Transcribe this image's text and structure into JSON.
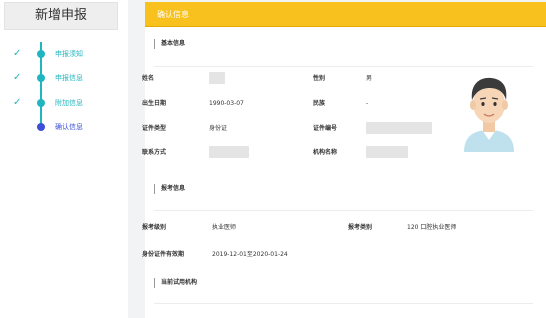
{
  "sidebar": {
    "title": "新增申报",
    "steps": [
      {
        "label": "申报须知",
        "done": true
      },
      {
        "label": "申报信息",
        "done": true
      },
      {
        "label": "附加信息",
        "done": true
      },
      {
        "label": "确认信息",
        "current": true
      }
    ],
    "check_icon": "✓"
  },
  "main": {
    "header_title": "确认信息",
    "basic_info": {
      "title": "基本信息",
      "name_label": "姓名",
      "gender_label": "性别",
      "gender": "男",
      "birth_label": "出生日期",
      "birth": "1990-03-07",
      "ethnicity_label": "民族",
      "ethnicity": "-",
      "id_type_label": "证件类型",
      "id_type": "身份证",
      "id_number_label": "证件编号",
      "contact_label": "联系方式",
      "org_label": "机构名称"
    },
    "exam_info": {
      "title": "报考信息",
      "level_label": "报考级别",
      "level": "执业医师",
      "category_label": "报考类别",
      "category": "120 口腔执业医师",
      "id_valid_label": "身份证件有效期",
      "id_valid": "2019-12-01至2020-01-24"
    },
    "trial_org": {
      "title": "当前试用机构"
    }
  },
  "colors": {
    "header_bg": "#f8c11d",
    "step_teal": "#21b5bf",
    "step_current": "#3d4fd6"
  }
}
